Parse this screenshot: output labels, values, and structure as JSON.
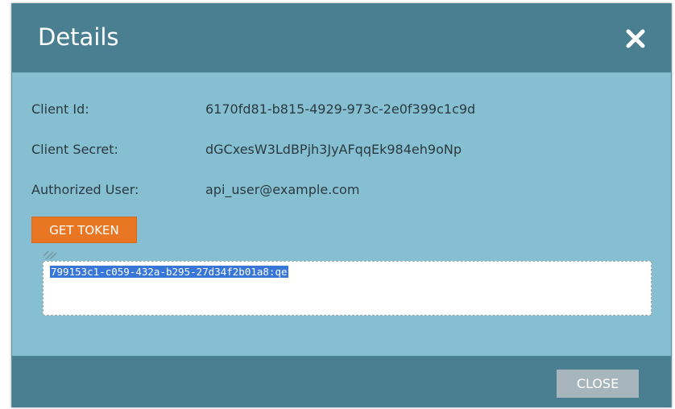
{
  "dialog": {
    "title": "Details",
    "close_icon": "close-icon"
  },
  "fields": [
    {
      "label": "Client Id:",
      "value": "6170fd81-b815-4929-973c-2e0f399c1c9d"
    },
    {
      "label": "Client Secret:",
      "value": "dGCxesW3LdBPjh3JyAFqqEk984eh9oNp"
    },
    {
      "label": "Authorized User:",
      "value": "api_user@example.com"
    }
  ],
  "get_token_label": "GET TOKEN",
  "token_output": "799153c1-c059-432a-b295-27d34f2b01a8:qe",
  "footer": {
    "close_label": "CLOSE"
  },
  "colors": {
    "header": "#497f91",
    "body": "#85bfd1",
    "button_accent": "#e87622",
    "selection": "#3876d8",
    "close_button": "#a7b6bc"
  }
}
